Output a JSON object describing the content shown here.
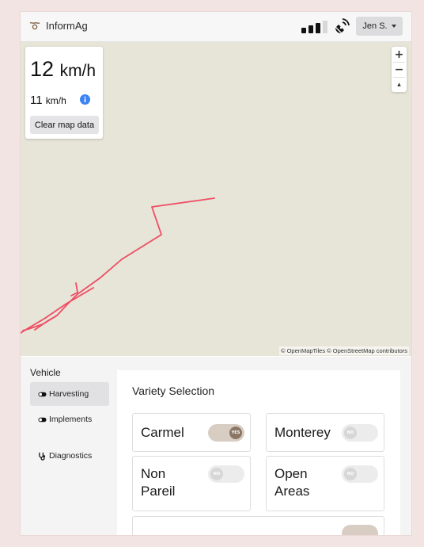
{
  "header": {
    "brand": "InformAg",
    "user_label": "Jen S."
  },
  "map": {
    "speed_primary_value": "12",
    "speed_primary_unit": "km/h",
    "speed_secondary_value": "11",
    "speed_secondary_unit": "km/h",
    "clear_label": "Clear map data",
    "zoom_in": "+",
    "zoom_out": "−",
    "reset_north": "▴",
    "attribution": "© OpenMapTiles © OpenStreetMap contributors",
    "track_color": "#ee4d63"
  },
  "sidebar": {
    "title": "Vehicle",
    "items": [
      {
        "label": "Harvesting",
        "icon": "toggle-icon"
      },
      {
        "label": "Implements",
        "icon": "toggle-icon"
      },
      {
        "label": "Diagnostics",
        "icon": "stethoscope-icon"
      }
    ]
  },
  "variety": {
    "title": "Variety Selection",
    "cards": [
      {
        "line1": "Carmel",
        "line2": "",
        "toggle_text": "YES",
        "enabled": true
      },
      {
        "line1": "Monterey",
        "line2": "",
        "toggle_text": "NO",
        "enabled": false
      },
      {
        "line1": "Non",
        "line2": "Pareil",
        "toggle_text": "NO",
        "enabled": false
      },
      {
        "line1": "Open",
        "line2": "Areas",
        "toggle_text": "NO",
        "enabled": false
      }
    ]
  },
  "colors": {
    "accent_on": "#8b7766",
    "info_blue": "#3b82f6"
  }
}
